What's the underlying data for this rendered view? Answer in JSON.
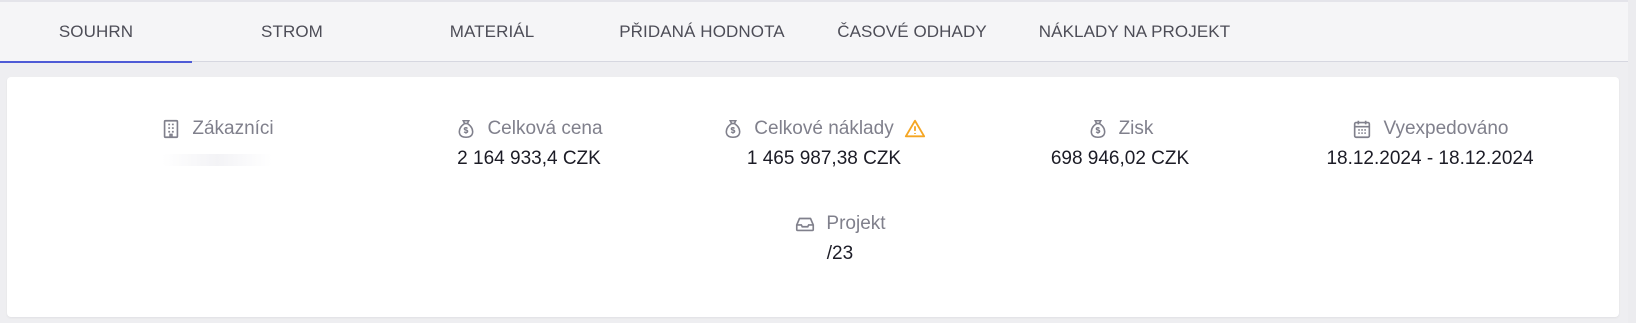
{
  "tabs": [
    {
      "label": "SOUHRN",
      "active": true
    },
    {
      "label": "STROM"
    },
    {
      "label": "MATERIÁL"
    },
    {
      "label": "PŘIDANÁ HODNOTA"
    },
    {
      "label": "ČASOVÉ ODHADY"
    },
    {
      "label": "NÁKLADY NA PROJEKT"
    }
  ],
  "summary": {
    "customers": {
      "label": "Zákazníci",
      "icon": "building-icon"
    },
    "total_price": {
      "label": "Celková cena",
      "value": "2 164 933,4 CZK",
      "icon": "money-bag-icon"
    },
    "total_costs": {
      "label": "Celkové náklady",
      "value": "1 465 987,38 CZK",
      "icon": "money-bag-icon",
      "warning_icon": "warning-icon",
      "warning_color": "#f5a623"
    },
    "profit": {
      "label": "Zisk",
      "value": "698 946,02 CZK",
      "icon": "money-bag-icon"
    },
    "shipped": {
      "label": "Vyexpedováno",
      "value": "18.12.2024 - 18.12.2024",
      "icon": "calendar-icon"
    },
    "project": {
      "label": "Projekt",
      "value": "/23",
      "icon": "inbox-icon"
    }
  },
  "colors": {
    "accent": "#4e5bd6",
    "label": "#80808c",
    "value": "#1c1c26"
  }
}
